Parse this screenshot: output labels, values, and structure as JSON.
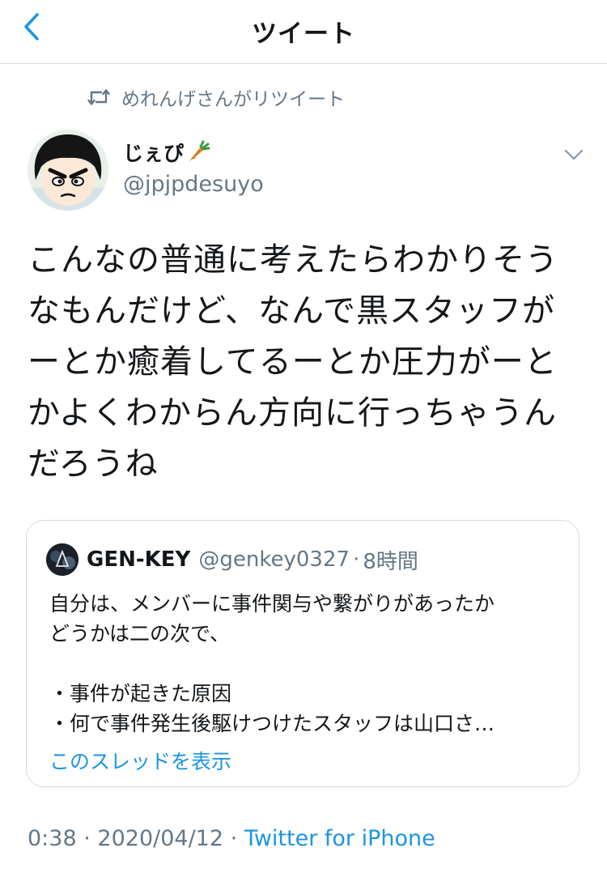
{
  "header": {
    "title": "ツイート",
    "back_icon": "chevron-left-icon"
  },
  "retweet": {
    "text": "めれんげさんがリツイート",
    "icon": "retweet-icon"
  },
  "tweet": {
    "author_name": "じぇぴ",
    "author_emoji": "carrot-icon",
    "handle": "@jpjpdesuyo",
    "text": "こんなの普通に考えたらわかりそう\nなもんだけど、なんで黒スタッフが\nーとか癒着してるーとか圧力がーと\nかよくわからん方向に行っちゃうん\nだろうね"
  },
  "quote": {
    "author_name": "GEN-KEY",
    "handle": "@genkey0327",
    "separator": "·",
    "time": "8時間",
    "text": "自分は、メンバーに事件関与や繋がりがあったか\nどうかは二の次で、\n\n・事件が起きた原因\n・何で事件発生後駆けつけたスタッフは山口さ…",
    "show_thread": "このスレッドを表示"
  },
  "footer": {
    "time": "0:38",
    "sep1": "·",
    "date": "2020/04/12",
    "sep2": "·",
    "source": "Twitter for iPhone"
  },
  "colors": {
    "accent": "#1b95e0",
    "muted": "#657786",
    "text": "#14171a",
    "border": "#d5dbe0"
  }
}
